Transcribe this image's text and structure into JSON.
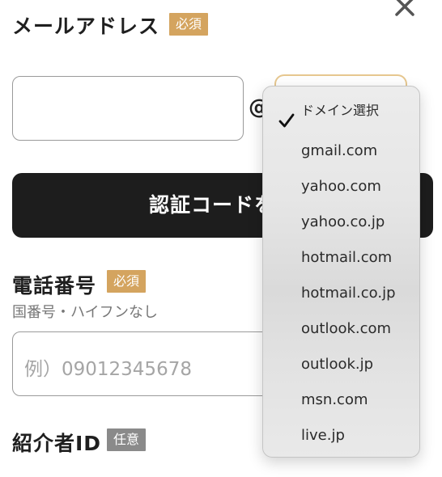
{
  "email": {
    "label": "メールアドレス",
    "badge": "必須",
    "at": "@"
  },
  "domain_menu": {
    "items": [
      {
        "label": "ドメイン選択",
        "selected": true
      },
      {
        "label": "gmail.com",
        "selected": false
      },
      {
        "label": "yahoo.com",
        "selected": false
      },
      {
        "label": "yahoo.co.jp",
        "selected": false
      },
      {
        "label": "hotmail.com",
        "selected": false
      },
      {
        "label": "hotmail.co.jp",
        "selected": false
      },
      {
        "label": "outlook.com",
        "selected": false
      },
      {
        "label": "outlook.jp",
        "selected": false
      },
      {
        "label": "msn.com",
        "selected": false
      },
      {
        "label": "live.jp",
        "selected": false
      }
    ]
  },
  "submit": {
    "label": "認証コードを送"
  },
  "phone": {
    "label": "電話番号",
    "badge": "必須",
    "hint": "国番号・ハイフンなし",
    "placeholder": "例）09012345678"
  },
  "referrer": {
    "label": "紹介者ID",
    "badge": "任意"
  },
  "colors": {
    "required_badge": "#d4a45f",
    "optional_badge": "#8a8a8a",
    "button": "#1d1d1d",
    "select_border": "#e6c78f"
  },
  "icons": {
    "close": "close-icon",
    "check": "checkmark-icon"
  }
}
